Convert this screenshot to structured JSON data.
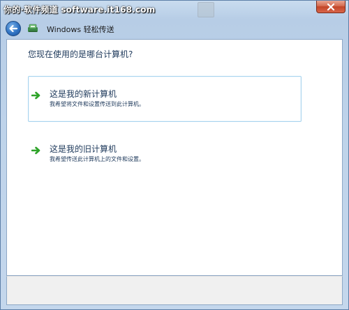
{
  "window": {
    "watermark": "你的·软件频道 software.it168.com",
    "app_title": "Windows 轻松传送"
  },
  "icons": {
    "close": "close-icon",
    "back": "back-arrow-icon",
    "app": "windows-easy-transfer-icon",
    "option_arrow": "green-arrow-icon"
  },
  "colors": {
    "close_button": "#c24527",
    "back_button": "#2f73c3",
    "arrow_green": "#2ea329",
    "heading_text": "#1e395b",
    "selection_border": "#a9d4ee"
  },
  "main": {
    "question": "您现在使用的是哪台计算机?",
    "options": [
      {
        "title": "这是我的新计算机",
        "description": "我希望将文件和设置传送到此计算机。",
        "selected": true
      },
      {
        "title": "这是我的旧计算机",
        "description": "我希望传送此计算机上的文件和设置。",
        "selected": false
      }
    ]
  }
}
